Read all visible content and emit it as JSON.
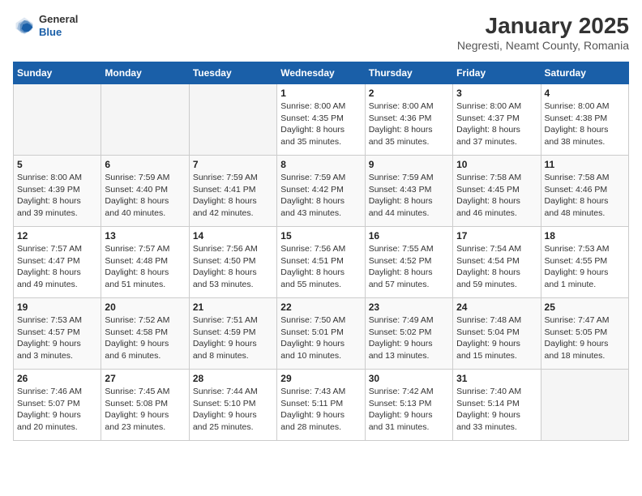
{
  "header": {
    "logo": {
      "general": "General",
      "blue": "Blue"
    },
    "title": "January 2025",
    "subtitle": "Negresti, Neamt County, Romania"
  },
  "calendar": {
    "days_of_week": [
      "Sunday",
      "Monday",
      "Tuesday",
      "Wednesday",
      "Thursday",
      "Friday",
      "Saturday"
    ],
    "weeks": [
      [
        {
          "day": "",
          "info": ""
        },
        {
          "day": "",
          "info": ""
        },
        {
          "day": "",
          "info": ""
        },
        {
          "day": "1",
          "info": "Sunrise: 8:00 AM\nSunset: 4:35 PM\nDaylight: 8 hours\nand 35 minutes."
        },
        {
          "day": "2",
          "info": "Sunrise: 8:00 AM\nSunset: 4:36 PM\nDaylight: 8 hours\nand 35 minutes."
        },
        {
          "day": "3",
          "info": "Sunrise: 8:00 AM\nSunset: 4:37 PM\nDaylight: 8 hours\nand 37 minutes."
        },
        {
          "day": "4",
          "info": "Sunrise: 8:00 AM\nSunset: 4:38 PM\nDaylight: 8 hours\nand 38 minutes."
        }
      ],
      [
        {
          "day": "5",
          "info": "Sunrise: 8:00 AM\nSunset: 4:39 PM\nDaylight: 8 hours\nand 39 minutes."
        },
        {
          "day": "6",
          "info": "Sunrise: 7:59 AM\nSunset: 4:40 PM\nDaylight: 8 hours\nand 40 minutes."
        },
        {
          "day": "7",
          "info": "Sunrise: 7:59 AM\nSunset: 4:41 PM\nDaylight: 8 hours\nand 42 minutes."
        },
        {
          "day": "8",
          "info": "Sunrise: 7:59 AM\nSunset: 4:42 PM\nDaylight: 8 hours\nand 43 minutes."
        },
        {
          "day": "9",
          "info": "Sunrise: 7:59 AM\nSunset: 4:43 PM\nDaylight: 8 hours\nand 44 minutes."
        },
        {
          "day": "10",
          "info": "Sunrise: 7:58 AM\nSunset: 4:45 PM\nDaylight: 8 hours\nand 46 minutes."
        },
        {
          "day": "11",
          "info": "Sunrise: 7:58 AM\nSunset: 4:46 PM\nDaylight: 8 hours\nand 48 minutes."
        }
      ],
      [
        {
          "day": "12",
          "info": "Sunrise: 7:57 AM\nSunset: 4:47 PM\nDaylight: 8 hours\nand 49 minutes."
        },
        {
          "day": "13",
          "info": "Sunrise: 7:57 AM\nSunset: 4:48 PM\nDaylight: 8 hours\nand 51 minutes."
        },
        {
          "day": "14",
          "info": "Sunrise: 7:56 AM\nSunset: 4:50 PM\nDaylight: 8 hours\nand 53 minutes."
        },
        {
          "day": "15",
          "info": "Sunrise: 7:56 AM\nSunset: 4:51 PM\nDaylight: 8 hours\nand 55 minutes."
        },
        {
          "day": "16",
          "info": "Sunrise: 7:55 AM\nSunset: 4:52 PM\nDaylight: 8 hours\nand 57 minutes."
        },
        {
          "day": "17",
          "info": "Sunrise: 7:54 AM\nSunset: 4:54 PM\nDaylight: 8 hours\nand 59 minutes."
        },
        {
          "day": "18",
          "info": "Sunrise: 7:53 AM\nSunset: 4:55 PM\nDaylight: 9 hours\nand 1 minute."
        }
      ],
      [
        {
          "day": "19",
          "info": "Sunrise: 7:53 AM\nSunset: 4:57 PM\nDaylight: 9 hours\nand 3 minutes."
        },
        {
          "day": "20",
          "info": "Sunrise: 7:52 AM\nSunset: 4:58 PM\nDaylight: 9 hours\nand 6 minutes."
        },
        {
          "day": "21",
          "info": "Sunrise: 7:51 AM\nSunset: 4:59 PM\nDaylight: 9 hours\nand 8 minutes."
        },
        {
          "day": "22",
          "info": "Sunrise: 7:50 AM\nSunset: 5:01 PM\nDaylight: 9 hours\nand 10 minutes."
        },
        {
          "day": "23",
          "info": "Sunrise: 7:49 AM\nSunset: 5:02 PM\nDaylight: 9 hours\nand 13 minutes."
        },
        {
          "day": "24",
          "info": "Sunrise: 7:48 AM\nSunset: 5:04 PM\nDaylight: 9 hours\nand 15 minutes."
        },
        {
          "day": "25",
          "info": "Sunrise: 7:47 AM\nSunset: 5:05 PM\nDaylight: 9 hours\nand 18 minutes."
        }
      ],
      [
        {
          "day": "26",
          "info": "Sunrise: 7:46 AM\nSunset: 5:07 PM\nDaylight: 9 hours\nand 20 minutes."
        },
        {
          "day": "27",
          "info": "Sunrise: 7:45 AM\nSunset: 5:08 PM\nDaylight: 9 hours\nand 23 minutes."
        },
        {
          "day": "28",
          "info": "Sunrise: 7:44 AM\nSunset: 5:10 PM\nDaylight: 9 hours\nand 25 minutes."
        },
        {
          "day": "29",
          "info": "Sunrise: 7:43 AM\nSunset: 5:11 PM\nDaylight: 9 hours\nand 28 minutes."
        },
        {
          "day": "30",
          "info": "Sunrise: 7:42 AM\nSunset: 5:13 PM\nDaylight: 9 hours\nand 31 minutes."
        },
        {
          "day": "31",
          "info": "Sunrise: 7:40 AM\nSunset: 5:14 PM\nDaylight: 9 hours\nand 33 minutes."
        },
        {
          "day": "",
          "info": ""
        }
      ]
    ]
  }
}
